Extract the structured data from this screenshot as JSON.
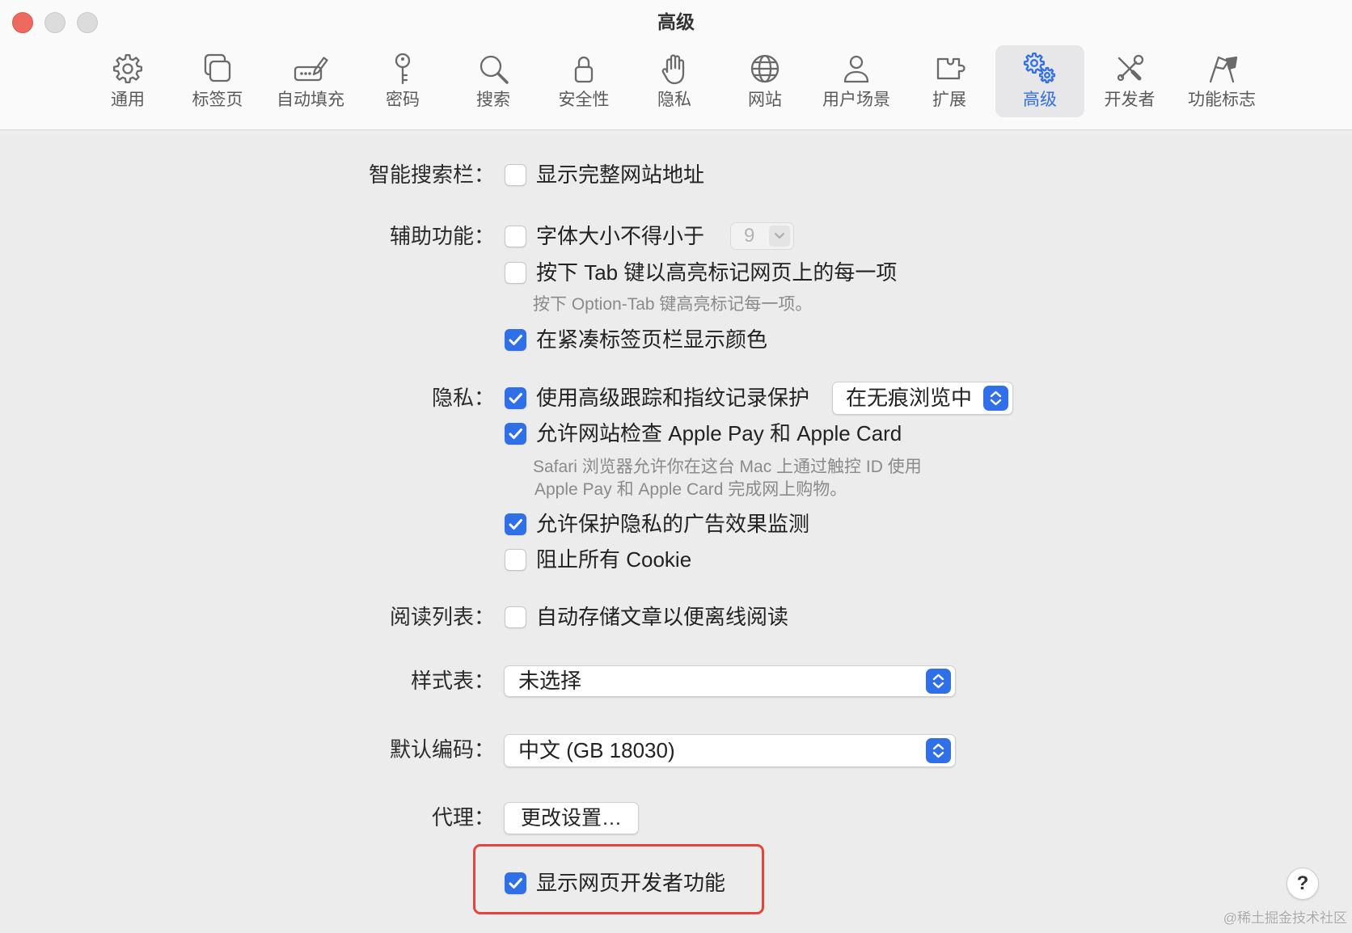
{
  "window": {
    "title": "高级"
  },
  "toolbar": {
    "items": [
      {
        "label": "通用",
        "icon": "gear-icon"
      },
      {
        "label": "标签页",
        "icon": "tabs-icon"
      },
      {
        "label": "自动填充",
        "icon": "autofill-icon"
      },
      {
        "label": "密码",
        "icon": "key-icon"
      },
      {
        "label": "搜索",
        "icon": "search-icon"
      },
      {
        "label": "安全性",
        "icon": "lock-icon"
      },
      {
        "label": "隐私",
        "icon": "hand-icon"
      },
      {
        "label": "网站",
        "icon": "globe-icon"
      },
      {
        "label": "用户场景",
        "icon": "person-icon"
      },
      {
        "label": "扩展",
        "icon": "puzzle-icon"
      },
      {
        "label": "高级",
        "icon": "gears-icon",
        "selected": true
      },
      {
        "label": "开发者",
        "icon": "tools-icon"
      },
      {
        "label": "功能标志",
        "icon": "flags-icon"
      }
    ]
  },
  "smart_search": {
    "label": "智能搜索栏：",
    "show_full_address": {
      "label": "显示完整网站地址",
      "checked": false
    }
  },
  "accessibility": {
    "label": "辅助功能：",
    "min_font": {
      "label": "字体大小不得小于",
      "checked": false,
      "value": "9"
    },
    "tab_highlight": {
      "label": "按下 Tab 键以高亮标记网页上的每一项",
      "checked": false,
      "note": "按下 Option-Tab 键高亮标记每一项。"
    },
    "compact_tab_color": {
      "label": "在紧凑标签页栏显示颜色",
      "checked": true
    }
  },
  "privacy": {
    "label": "隐私：",
    "tracking_protection": {
      "label": "使用高级跟踪和指纹记录保护",
      "checked": true,
      "mode": "在无痕浏览中"
    },
    "apple_pay": {
      "label": "允许网站检查 Apple Pay 和 Apple Card",
      "checked": true,
      "note_lines": [
        "Safari 浏览器允许你在这台 Mac 上通过触控 ID 使用",
        "Apple Pay 和 Apple Card 完成网上购物。"
      ]
    },
    "ad_measurement": {
      "label": "允许保护隐私的广告效果监测",
      "checked": true
    },
    "block_cookies": {
      "label": "阻止所有 Cookie",
      "checked": false
    }
  },
  "reading_list": {
    "label": "阅读列表：",
    "save_offline": {
      "label": "自动存储文章以便离线阅读",
      "checked": false
    }
  },
  "style_sheet": {
    "label": "样式表：",
    "value": "未选择"
  },
  "encoding": {
    "label": "默认编码：",
    "value": "中文 (GB 18030)"
  },
  "proxy": {
    "label": "代理：",
    "button": "更改设置…"
  },
  "developer": {
    "show_develop_features": {
      "label": "显示网页开发者功能",
      "checked": true
    }
  },
  "help": {
    "label": "?"
  },
  "watermark": "@稀土掘金技术社区",
  "colors": {
    "accent": "#2f6fe8",
    "close": "#ee6a5f",
    "highlight_border": "#e3453b",
    "selected_tab_bg": "#e7e7e9"
  }
}
